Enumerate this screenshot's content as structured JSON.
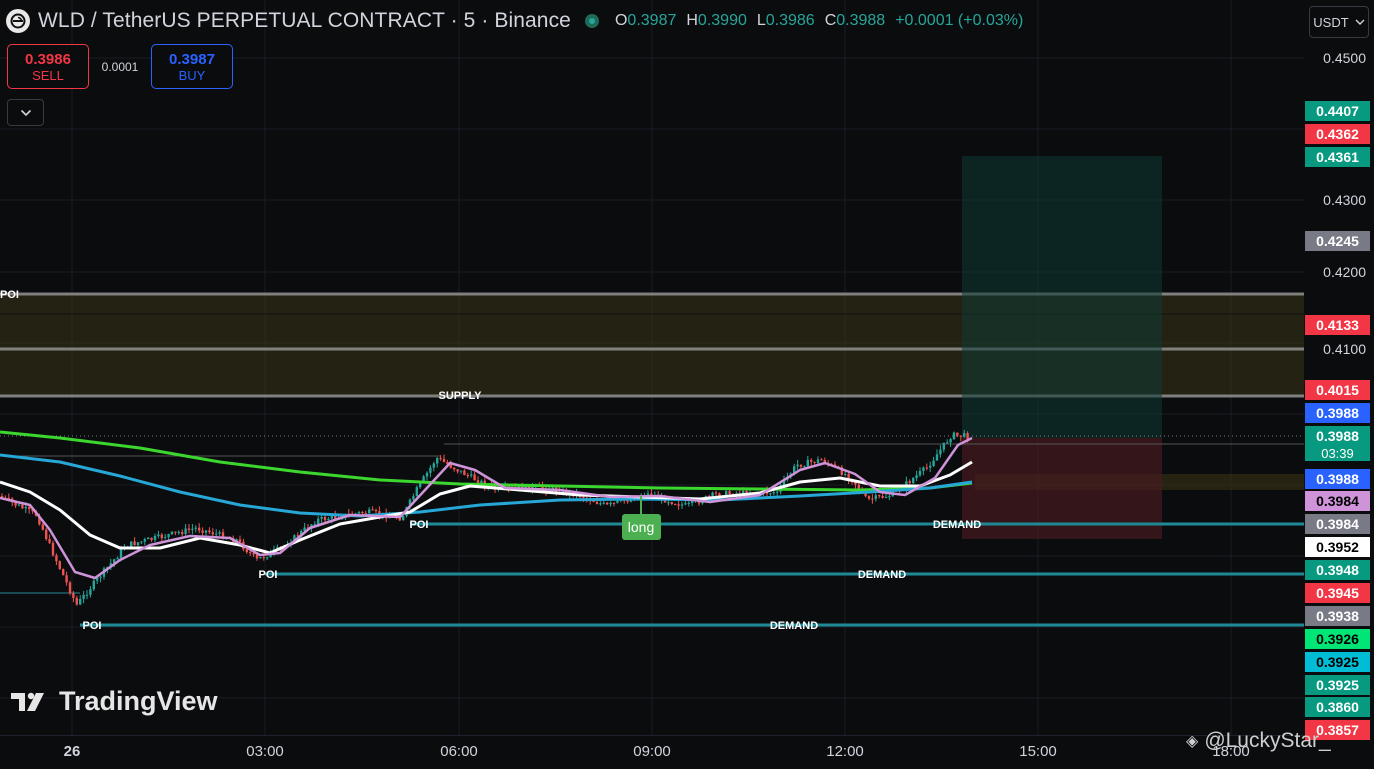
{
  "header": {
    "symbol_title": "WLD / TetherUS PERPETUAL CONTRACT · 5 · Binance",
    "ohlc": {
      "o_key": "O",
      "o_val": "0.3987",
      "h_key": "H",
      "h_val": "0.3990",
      "l_key": "L",
      "l_val": "0.3986",
      "c_key": "C",
      "c_val": "0.3988",
      "change": "+0.0001 (+0.03%)"
    }
  },
  "trade": {
    "sell_price": "0.3986",
    "sell_label": "SELL",
    "spread": "0.0001",
    "buy_price": "0.3987",
    "buy_label": "BUY"
  },
  "currency": "USDT",
  "price_axis": {
    "ticks": [
      "0.4500",
      "0.4300",
      "0.4200",
      "0.4100"
    ],
    "badges": [
      {
        "text": "0.4407",
        "bg": "#089981",
        "fg": "#ffffff"
      },
      {
        "text": "0.4362",
        "bg": "#f23645",
        "fg": "#ffffff"
      },
      {
        "text": "0.4361",
        "bg": "#089981",
        "fg": "#ffffff"
      },
      {
        "text": "0.4245",
        "bg": "#787b86",
        "fg": "#ffffff"
      },
      {
        "text": "0.4133",
        "bg": "#f23645",
        "fg": "#ffffff"
      },
      {
        "text": "0.4015",
        "bg": "#f23645",
        "fg": "#ffffff"
      },
      {
        "text": "0.3988",
        "bg": "#2962ff",
        "fg": "#ffffff"
      },
      {
        "text": "0.3988",
        "bg": "#089981",
        "fg": "#ffffff"
      },
      {
        "text": "0.3988",
        "bg": "#2962ff",
        "fg": "#ffffff"
      },
      {
        "text": "0.3984",
        "bg": "#ce93d8",
        "fg": "#000000"
      },
      {
        "text": "0.3984",
        "bg": "#787b86",
        "fg": "#ffffff"
      },
      {
        "text": "0.3952",
        "bg": "#ffffff",
        "fg": "#000000"
      },
      {
        "text": "0.3948",
        "bg": "#089981",
        "fg": "#ffffff"
      },
      {
        "text": "0.3945",
        "bg": "#f23645",
        "fg": "#ffffff"
      },
      {
        "text": "0.3938",
        "bg": "#787b86",
        "fg": "#ffffff"
      },
      {
        "text": "0.3926",
        "bg": "#00e676",
        "fg": "#000000"
      },
      {
        "text": "0.3925",
        "bg": "#00bcd4",
        "fg": "#000000"
      },
      {
        "text": "0.3925",
        "bg": "#089981",
        "fg": "#ffffff"
      },
      {
        "text": "0.3860",
        "bg": "#089981",
        "fg": "#ffffff"
      },
      {
        "text": "0.3857",
        "bg": "#f23645",
        "fg": "#ffffff"
      }
    ],
    "countdown": "03:39"
  },
  "time_axis": {
    "labels": [
      "26",
      "03:00",
      "06:00",
      "09:00",
      "12:00",
      "15:00",
      "18:00"
    ]
  },
  "annotations": {
    "poi": "POI",
    "supply": "SUPPLY",
    "demand": "DEMAND",
    "long": "long"
  },
  "watermark": "TradingView",
  "author": "@LuckyStar_",
  "colors": {
    "bull": "#26a69a",
    "bear": "#ef5350",
    "ema_white": "#ffffff",
    "ema_blue": "#26a7d6",
    "ema_green": "#3bd62e",
    "ema_purple": "#ce93d8"
  }
}
